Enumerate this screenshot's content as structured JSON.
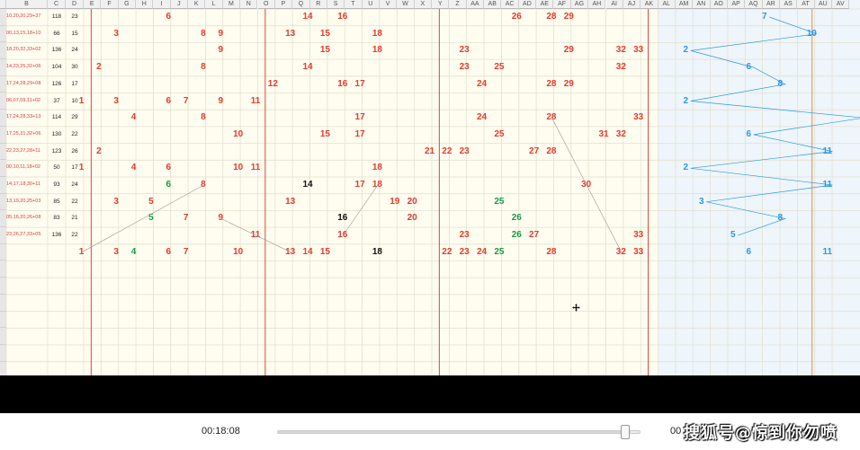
{
  "columns": [
    "B",
    "C",
    "D",
    "E",
    "F",
    "G",
    "H",
    "I",
    "J",
    "K",
    "L",
    "M",
    "N",
    "O",
    "P",
    "Q",
    "R",
    "S",
    "T",
    "U",
    "V",
    "W",
    "X",
    "Y",
    "Z",
    "AA",
    "AB",
    "AC",
    "AD",
    "AE",
    "AF",
    "AG",
    "AH",
    "AI",
    "AJ",
    "AK",
    "AL",
    "AM",
    "AN",
    "AO",
    "AP",
    "AQ",
    "AR",
    "AS",
    "AT",
    "AU",
    "AV"
  ],
  "rows": [
    {
      "label": "10,20,20,29+37",
      "c": "118",
      "d": "23",
      "nums": [
        {
          "v": "6",
          "k": "red"
        },
        {
          "v": "14",
          "k": "red"
        },
        {
          "v": "16",
          "k": "red"
        },
        {
          "v": "26",
          "k": "red"
        },
        {
          "v": "28",
          "k": "red"
        },
        {
          "v": "29",
          "k": "red"
        }
      ],
      "blue": "7"
    },
    {
      "label": "00,13,15,18+10",
      "c": "66",
      "d": "15",
      "nums": [
        {
          "v": "3",
          "k": "red"
        },
        {
          "v": "8",
          "k": "red"
        },
        {
          "v": "9",
          "k": "red"
        },
        {
          "v": "13",
          "k": "red"
        },
        {
          "v": "15",
          "k": "red"
        },
        {
          "v": "18",
          "k": "red"
        }
      ],
      "blue": "10"
    },
    {
      "label": "18,20,32,33+02",
      "c": "136",
      "d": "24",
      "nums": [
        {
          "v": "9",
          "k": "red"
        },
        {
          "v": "15",
          "k": "red"
        },
        {
          "v": "18",
          "k": "red"
        },
        {
          "v": "23",
          "k": "red"
        },
        {
          "v": "29",
          "k": "red"
        },
        {
          "v": "32",
          "k": "red"
        },
        {
          "v": "33",
          "k": "red"
        }
      ],
      "blue": "2"
    },
    {
      "label": "14,23,25,32+06",
      "c": "104",
      "d": "30",
      "nums": [
        {
          "v": "2",
          "k": "red"
        },
        {
          "v": "8",
          "k": "red"
        },
        {
          "v": "14",
          "k": "red"
        },
        {
          "v": "23",
          "k": "red"
        },
        {
          "v": "25",
          "k": "red"
        },
        {
          "v": "32",
          "k": "red"
        }
      ],
      "blue": "6"
    },
    {
      "label": "17,24,28,29+08",
      "c": "126",
      "d": "17",
      "nums": [
        {
          "v": "12",
          "k": "red"
        },
        {
          "v": "16",
          "k": "red"
        },
        {
          "v": "17",
          "k": "red"
        },
        {
          "v": "24",
          "k": "red"
        },
        {
          "v": "28",
          "k": "red"
        },
        {
          "v": "29",
          "k": "red"
        }
      ],
      "blue": "8"
    },
    {
      "label": "06,07,09,11+02",
      "c": "37",
      "d": "10",
      "nums": [
        {
          "v": "1",
          "k": "red"
        },
        {
          "v": "3",
          "k": "red"
        },
        {
          "v": "6",
          "k": "red"
        },
        {
          "v": "7",
          "k": "red"
        },
        {
          "v": "9",
          "k": "red"
        },
        {
          "v": "11",
          "k": "red"
        }
      ],
      "blue": "2"
    },
    {
      "label": "17,24,28,33+13",
      "c": "114",
      "d": "29",
      "nums": [
        {
          "v": "4",
          "k": "red"
        },
        {
          "v": "8",
          "k": "red"
        },
        {
          "v": "17",
          "k": "red"
        },
        {
          "v": "24",
          "k": "red"
        },
        {
          "v": "28",
          "k": "red"
        },
        {
          "v": "33",
          "k": "red"
        }
      ],
      "blue": ""
    },
    {
      "label": "17,25,31,32+06",
      "c": "130",
      "d": "22",
      "nums": [
        {
          "v": "10",
          "k": "red"
        },
        {
          "v": "15",
          "k": "red"
        },
        {
          "v": "17",
          "k": "red"
        },
        {
          "v": "25",
          "k": "red"
        },
        {
          "v": "31",
          "k": "red"
        },
        {
          "v": "32",
          "k": "red"
        }
      ],
      "blue": "6"
    },
    {
      "label": "22,23,27,28+11",
      "c": "123",
      "d": "26",
      "nums": [
        {
          "v": "2",
          "k": "red"
        },
        {
          "v": "21",
          "k": "red"
        },
        {
          "v": "22",
          "k": "red"
        },
        {
          "v": "23",
          "k": "red"
        },
        {
          "v": "27",
          "k": "red"
        },
        {
          "v": "28",
          "k": "red"
        }
      ],
      "blue": "11"
    },
    {
      "label": "00,10,11,18+02",
      "c": "50",
      "d": "17",
      "nums": [
        {
          "v": "1",
          "k": "red"
        },
        {
          "v": "4",
          "k": "red"
        },
        {
          "v": "6",
          "k": "red"
        },
        {
          "v": "10",
          "k": "red"
        },
        {
          "v": "11",
          "k": "red"
        },
        {
          "v": "18",
          "k": "red"
        }
      ],
      "blue": "2"
    },
    {
      "label": "14,17,18,30+11",
      "c": "93",
      "d": "24",
      "nums": [
        {
          "v": "6",
          "k": "green"
        },
        {
          "v": "8",
          "k": "red"
        },
        {
          "v": "14",
          "k": "black"
        },
        {
          "v": "17",
          "k": "red"
        },
        {
          "v": "18",
          "k": "red"
        },
        {
          "v": "30",
          "k": "red"
        }
      ],
      "blue": "11"
    },
    {
      "label": "13,19,20,25+03",
      "c": "85",
      "d": "22",
      "nums": [
        {
          "v": "3",
          "k": "red"
        },
        {
          "v": "5",
          "k": "red"
        },
        {
          "v": "13",
          "k": "red"
        },
        {
          "v": "19",
          "k": "red"
        },
        {
          "v": "20",
          "k": "red"
        },
        {
          "v": "25",
          "k": "green"
        }
      ],
      "blue": "3"
    },
    {
      "label": "05,16,20,26+08",
      "c": "83",
      "d": "21",
      "nums": [
        {
          "v": "5",
          "k": "green"
        },
        {
          "v": "7",
          "k": "red"
        },
        {
          "v": "9",
          "k": "red"
        },
        {
          "v": "16",
          "k": "black"
        },
        {
          "v": "20",
          "k": "red"
        },
        {
          "v": "26",
          "k": "green"
        }
      ],
      "blue": "8"
    },
    {
      "label": "23,26,27,33+05",
      "c": "136",
      "d": "22",
      "nums": [
        {
          "v": "11",
          "k": "red"
        },
        {
          "v": "16",
          "k": "red"
        },
        {
          "v": "23",
          "k": "red"
        },
        {
          "v": "26",
          "k": "green"
        },
        {
          "v": "27",
          "k": "red"
        },
        {
          "v": "33",
          "k": "red"
        }
      ],
      "blue": "5"
    },
    {
      "label": "",
      "c": "",
      "d": "",
      "nums": [
        {
          "v": "1",
          "k": "red"
        },
        {
          "v": "3",
          "k": "red"
        },
        {
          "v": "4",
          "k": "green"
        },
        {
          "v": "6",
          "k": "red"
        },
        {
          "v": "7",
          "k": "red"
        },
        {
          "v": "10",
          "k": "red"
        },
        {
          "v": "13",
          "k": "red"
        },
        {
          "v": "14",
          "k": "red"
        },
        {
          "v": "15",
          "k": "red"
        },
        {
          "v": "18",
          "k": "black"
        },
        {
          "v": "22",
          "k": "red"
        },
        {
          "v": "23",
          "k": "red"
        },
        {
          "v": "24",
          "k": "red"
        },
        {
          "v": "25",
          "k": "green"
        },
        {
          "v": "28",
          "k": "red"
        },
        {
          "v": "32",
          "k": "red"
        },
        {
          "v": "33",
          "k": "red"
        }
      ],
      "blue": "6",
      "blue2": "11"
    }
  ],
  "colors": {
    "red": "#e53b2c",
    "green": "#1b9a47",
    "black": "#111111",
    "blue": "#2b9ae0",
    "divider": "#d9473f"
  },
  "player": {
    "time_current": "00:18:08",
    "time_total": "00",
    "progress": 0.97,
    "watermark": "搜狐号@惊到你勿喷"
  },
  "icons": {
    "cursor": "move-cursor-icon"
  }
}
